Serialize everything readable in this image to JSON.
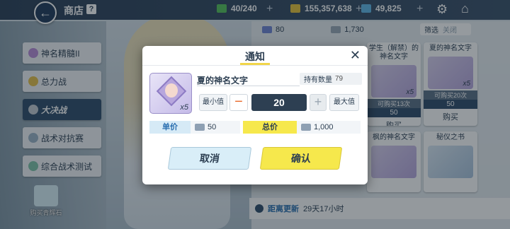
{
  "header": {
    "back_symbol": "←",
    "title": "商店",
    "help_symbol": "?",
    "ap": "40/240",
    "credits": "155,357,638",
    "gems": "49,825",
    "plus_symbol": "+",
    "gear_symbol": "⚙",
    "home_symbol": "⌂"
  },
  "sidebar": {
    "items": [
      {
        "label": "神名精髓II"
      },
      {
        "label": "总力战"
      },
      {
        "label": "大决战"
      },
      {
        "label": "战术对抗赛"
      },
      {
        "label": "综合战术测试"
      }
    ],
    "buy_stone": "购买青辉石"
  },
  "shop": {
    "currency_a": "80",
    "currency_b": "1,730",
    "filter_label": "筛选",
    "filter_state": "关闭",
    "cards": [
      {
        "name": "学生（解禁）的神名文字",
        "count": "x5",
        "limit": "可购买13次",
        "price": "50",
        "buy": "购买"
      },
      {
        "name": "夏的神名文字",
        "count": "x5",
        "limit": "可购买20次",
        "price": "50",
        "buy": "购买"
      },
      {
        "name": "枫的神名文字",
        "count": "",
        "limit": "",
        "price": "",
        "buy": ""
      },
      {
        "name": "秘仪之书",
        "count": "",
        "limit": "",
        "price": "",
        "buy": ""
      }
    ],
    "refresh_label": "距离更新",
    "refresh_time": "29天17小时"
  },
  "dialog": {
    "title": "通知",
    "close_symbol": "✕",
    "item_name": "夏的神名文字",
    "item_count": "x5",
    "owned_label": "持有数量",
    "owned_value": "79",
    "min_label": "最小值",
    "minus_symbol": "−",
    "quantity": "20",
    "plus_symbol": "+",
    "max_label": "最大值",
    "unit_price_label": "单价",
    "unit_price": "50",
    "total_label": "总价",
    "total_price": "1,000",
    "cancel_label": "取消",
    "confirm_label": "确认"
  }
}
